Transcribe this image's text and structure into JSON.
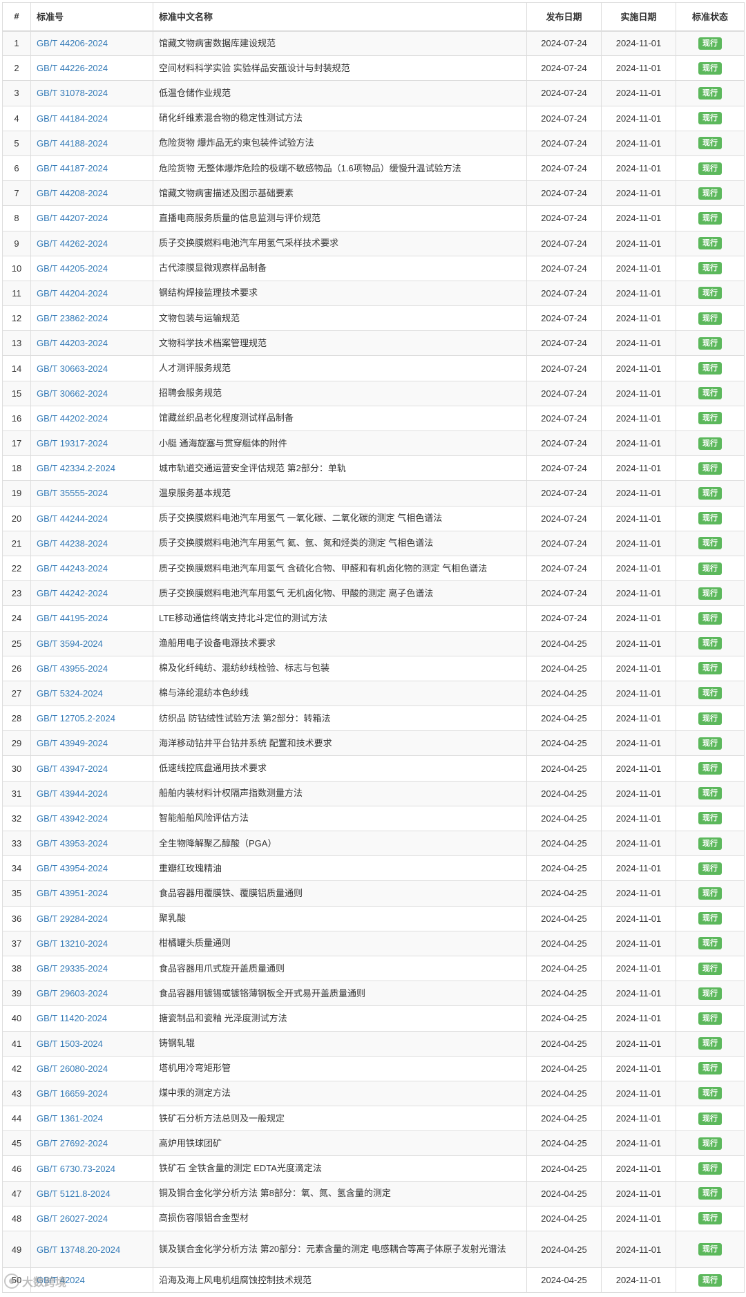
{
  "table": {
    "headers": [
      "#",
      "标准号",
      "标准中文名称",
      "发布日期",
      "实施日期",
      "标准状态"
    ],
    "rows": [
      {
        "num": "1",
        "code": "GB/T 44206-2024",
        "name": "馆藏文物病害数据库建设规范",
        "pub": "2024-07-24",
        "impl": "2024-11-01",
        "status": "现行"
      },
      {
        "num": "2",
        "code": "GB/T 44226-2024",
        "name": "空间材料科学实验 实验样品安瓿设计与封装规范",
        "pub": "2024-07-24",
        "impl": "2024-11-01",
        "status": "现行"
      },
      {
        "num": "3",
        "code": "GB/T 31078-2024",
        "name": "低温仓储作业规范",
        "pub": "2024-07-24",
        "impl": "2024-11-01",
        "status": "现行"
      },
      {
        "num": "4",
        "code": "GB/T 44184-2024",
        "name": "硝化纤维素混合物的稳定性测试方法",
        "pub": "2024-07-24",
        "impl": "2024-11-01",
        "status": "现行"
      },
      {
        "num": "5",
        "code": "GB/T 44188-2024",
        "name": "危险货物 爆炸品无约束包装件试验方法",
        "pub": "2024-07-24",
        "impl": "2024-11-01",
        "status": "现行"
      },
      {
        "num": "6",
        "code": "GB/T 44187-2024",
        "name": "危险货物 无整体爆炸危险的极端不敏感物品（1.6项物品）缓慢升温试验方法",
        "pub": "2024-07-24",
        "impl": "2024-11-01",
        "status": "现行"
      },
      {
        "num": "7",
        "code": "GB/T 44208-2024",
        "name": "馆藏文物病害描述及图示基础要素",
        "pub": "2024-07-24",
        "impl": "2024-11-01",
        "status": "现行"
      },
      {
        "num": "8",
        "code": "GB/T 44207-2024",
        "name": "直播电商服务质量的信息监测与评价规范",
        "pub": "2024-07-24",
        "impl": "2024-11-01",
        "status": "现行"
      },
      {
        "num": "9",
        "code": "GB/T 44262-2024",
        "name": "质子交换膜燃料电池汽车用氢气采样技术要求",
        "pub": "2024-07-24",
        "impl": "2024-11-01",
        "status": "现行"
      },
      {
        "num": "10",
        "code": "GB/T 44205-2024",
        "name": "古代漆膜显微观察样品制备",
        "pub": "2024-07-24",
        "impl": "2024-11-01",
        "status": "现行"
      },
      {
        "num": "11",
        "code": "GB/T 44204-2024",
        "name": "钢结构焊接监理技术要求",
        "pub": "2024-07-24",
        "impl": "2024-11-01",
        "status": "现行"
      },
      {
        "num": "12",
        "code": "GB/T 23862-2024",
        "name": "文物包装与运输规范",
        "pub": "2024-07-24",
        "impl": "2024-11-01",
        "status": "现行"
      },
      {
        "num": "13",
        "code": "GB/T 44203-2024",
        "name": "文物科学技术档案管理规范",
        "pub": "2024-07-24",
        "impl": "2024-11-01",
        "status": "现行"
      },
      {
        "num": "14",
        "code": "GB/T 30663-2024",
        "name": "人才测评服务规范",
        "pub": "2024-07-24",
        "impl": "2024-11-01",
        "status": "现行"
      },
      {
        "num": "15",
        "code": "GB/T 30662-2024",
        "name": "招聘会服务规范",
        "pub": "2024-07-24",
        "impl": "2024-11-01",
        "status": "现行"
      },
      {
        "num": "16",
        "code": "GB/T 44202-2024",
        "name": "馆藏丝织品老化程度测试样品制备",
        "pub": "2024-07-24",
        "impl": "2024-11-01",
        "status": "现行"
      },
      {
        "num": "17",
        "code": "GB/T 19317-2024",
        "name": "小艇 通海旋塞与贯穿艇体的附件",
        "pub": "2024-07-24",
        "impl": "2024-11-01",
        "status": "现行"
      },
      {
        "num": "18",
        "code": "GB/T 42334.2-2024",
        "name": "城市轨道交通运营安全评估规范 第2部分：单轨",
        "pub": "2024-07-24",
        "impl": "2024-11-01",
        "status": "现行"
      },
      {
        "num": "19",
        "code": "GB/T 35555-2024",
        "name": "温泉服务基本规范",
        "pub": "2024-07-24",
        "impl": "2024-11-01",
        "status": "现行"
      },
      {
        "num": "20",
        "code": "GB/T 44244-2024",
        "name": "质子交换膜燃料电池汽车用氢气 一氧化碳、二氧化碳的测定 气相色谱法",
        "pub": "2024-07-24",
        "impl": "2024-11-01",
        "status": "现行"
      },
      {
        "num": "21",
        "code": "GB/T 44238-2024",
        "name": "质子交换膜燃料电池汽车用氢气 氦、氩、氮和烃类的测定 气相色谱法",
        "pub": "2024-07-24",
        "impl": "2024-11-01",
        "status": "现行"
      },
      {
        "num": "22",
        "code": "GB/T 44243-2024",
        "name": "质子交换膜燃料电池汽车用氢气 含硫化合物、甲醛和有机卤化物的测定 气相色谱法",
        "pub": "2024-07-24",
        "impl": "2024-11-01",
        "status": "现行"
      },
      {
        "num": "23",
        "code": "GB/T 44242-2024",
        "name": "质子交换膜燃料电池汽车用氢气 无机卤化物、甲酸的测定 离子色谱法",
        "pub": "2024-07-24",
        "impl": "2024-11-01",
        "status": "现行"
      },
      {
        "num": "24",
        "code": "GB/T 44195-2024",
        "name": "LTE移动通信终端支持北斗定位的测试方法",
        "pub": "2024-07-24",
        "impl": "2024-11-01",
        "status": "现行"
      },
      {
        "num": "25",
        "code": "GB/T 3594-2024",
        "name": "渔船用电子设备电源技术要求",
        "pub": "2024-04-25",
        "impl": "2024-11-01",
        "status": "现行"
      },
      {
        "num": "26",
        "code": "GB/T 43955-2024",
        "name": "棉及化纤纯纺、混纺纱线检验、标志与包装",
        "pub": "2024-04-25",
        "impl": "2024-11-01",
        "status": "现行"
      },
      {
        "num": "27",
        "code": "GB/T 5324-2024",
        "name": "棉与涤纶混纺本色纱线",
        "pub": "2024-04-25",
        "impl": "2024-11-01",
        "status": "现行"
      },
      {
        "num": "28",
        "code": "GB/T 12705.2-2024",
        "name": "纺织品 防钻绒性试验方法 第2部分：转箱法",
        "pub": "2024-04-25",
        "impl": "2024-11-01",
        "status": "现行"
      },
      {
        "num": "29",
        "code": "GB/T 43949-2024",
        "name": "海洋移动钻井平台钻井系统 配置和技术要求",
        "pub": "2024-04-25",
        "impl": "2024-11-01",
        "status": "现行"
      },
      {
        "num": "30",
        "code": "GB/T 43947-2024",
        "name": "低速线控底盘通用技术要求",
        "pub": "2024-04-25",
        "impl": "2024-11-01",
        "status": "现行"
      },
      {
        "num": "31",
        "code": "GB/T 43944-2024",
        "name": "船舶内装材料计权隔声指数测量方法",
        "pub": "2024-04-25",
        "impl": "2024-11-01",
        "status": "现行"
      },
      {
        "num": "32",
        "code": "GB/T 43942-2024",
        "name": "智能船舶风险评估方法",
        "pub": "2024-04-25",
        "impl": "2024-11-01",
        "status": "现行"
      },
      {
        "num": "33",
        "code": "GB/T 43953-2024",
        "name": "全生物降解聚乙醇酸（PGA）",
        "pub": "2024-04-25",
        "impl": "2024-11-01",
        "status": "现行"
      },
      {
        "num": "34",
        "code": "GB/T 43954-2024",
        "name": "重瓣红玫瑰精油",
        "pub": "2024-04-25",
        "impl": "2024-11-01",
        "status": "现行"
      },
      {
        "num": "35",
        "code": "GB/T 43951-2024",
        "name": "食品容器用覆膜铁、覆膜铝质量通则",
        "pub": "2024-04-25",
        "impl": "2024-11-01",
        "status": "现行"
      },
      {
        "num": "36",
        "code": "GB/T 29284-2024",
        "name": "聚乳酸",
        "pub": "2024-04-25",
        "impl": "2024-11-01",
        "status": "现行"
      },
      {
        "num": "37",
        "code": "GB/T 13210-2024",
        "name": "柑橘罐头质量通则",
        "pub": "2024-04-25",
        "impl": "2024-11-01",
        "status": "现行"
      },
      {
        "num": "38",
        "code": "GB/T 29335-2024",
        "name": "食品容器用爪式旋开盖质量通则",
        "pub": "2024-04-25",
        "impl": "2024-11-01",
        "status": "现行"
      },
      {
        "num": "39",
        "code": "GB/T 29603-2024",
        "name": "食品容器用镀锡或镀铬薄钢板全开式易开盖质量通则",
        "pub": "2024-04-25",
        "impl": "2024-11-01",
        "status": "现行"
      },
      {
        "num": "40",
        "code": "GB/T 11420-2024",
        "name": "搪瓷制品和瓷釉 光泽度测试方法",
        "pub": "2024-04-25",
        "impl": "2024-11-01",
        "status": "现行"
      },
      {
        "num": "41",
        "code": "GB/T 1503-2024",
        "name": "铸钢轧辊",
        "pub": "2024-04-25",
        "impl": "2024-11-01",
        "status": "现行"
      },
      {
        "num": "42",
        "code": "GB/T 26080-2024",
        "name": "塔机用冷弯矩形管",
        "pub": "2024-04-25",
        "impl": "2024-11-01",
        "status": "现行"
      },
      {
        "num": "43",
        "code": "GB/T 16659-2024",
        "name": "煤中汞的测定方法",
        "pub": "2024-04-25",
        "impl": "2024-11-01",
        "status": "现行"
      },
      {
        "num": "44",
        "code": "GB/T 1361-2024",
        "name": "铁矿石分析方法总则及一般规定",
        "pub": "2024-04-25",
        "impl": "2024-11-01",
        "status": "现行"
      },
      {
        "num": "45",
        "code": "GB/T 27692-2024",
        "name": "高炉用铁球团矿",
        "pub": "2024-04-25",
        "impl": "2024-11-01",
        "status": "现行"
      },
      {
        "num": "46",
        "code": "GB/T 6730.73-2024",
        "name": "铁矿石 全铁含量的测定 EDTA光度滴定法",
        "pub": "2024-04-25",
        "impl": "2024-11-01",
        "status": "现行"
      },
      {
        "num": "47",
        "code": "GB/T 5121.8-2024",
        "name": "铜及铜合金化学分析方法 第8部分：氧、氮、氢含量的测定",
        "pub": "2024-04-25",
        "impl": "2024-11-01",
        "status": "现行"
      },
      {
        "num": "48",
        "code": "GB/T 26027-2024",
        "name": "高损伤容限铝合金型材",
        "pub": "2024-04-25",
        "impl": "2024-11-01",
        "status": "现行"
      },
      {
        "num": "49",
        "code": "GB/T 13748.20-2024",
        "name": "镁及镁合金化学分析方法 第20部分：元素含量的测定 电感耦合等离子体原子发射光谱法",
        "pub": "2024-04-25",
        "impl": "2024-11-01",
        "status": "现行"
      },
      {
        "num": "50",
        "code": "GB/T 42024",
        "name": "沿海及海上风电机组腐蚀控制技术规范",
        "pub": "2024-04-25",
        "impl": "2024-11-01",
        "status": "现行"
      }
    ]
  },
  "watermark": {
    "text": "大数跨境"
  },
  "colors": {
    "link": "#337ab7",
    "badge": "#5cb85c",
    "stripe": "#f9f9f9",
    "border": "#dddddd"
  }
}
